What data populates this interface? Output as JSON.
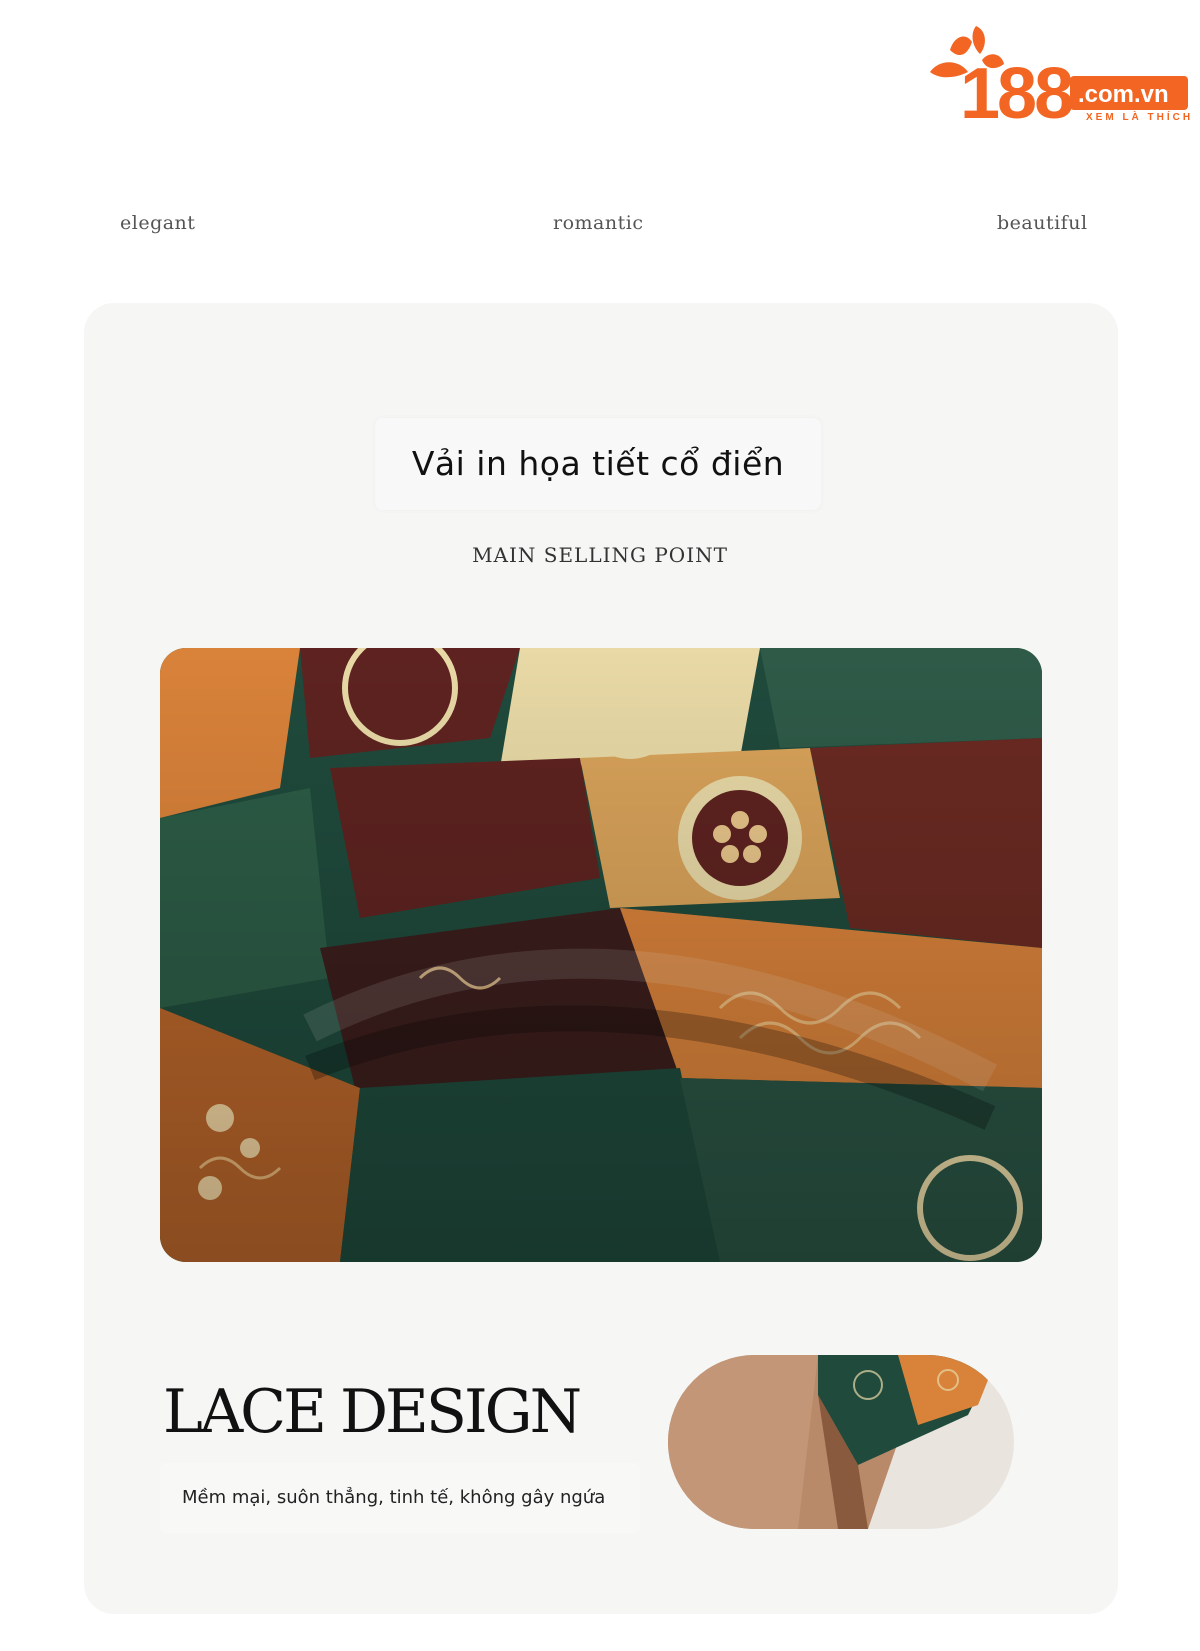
{
  "logo": {
    "number": "188",
    "domain": ".com.vn",
    "slogan": "XEM LÀ THÍCH",
    "brand_color": "#f26522"
  },
  "tags": [
    "elegant",
    "romantic",
    "beautiful"
  ],
  "section": {
    "title": "Vải in họa tiết cổ điển",
    "subtitle": "MAIN SELLING POINT"
  },
  "lace": {
    "title": "LACE DESIGN",
    "description": "Mềm mại, suôn thẳng, tinh tế, không gây ngứa"
  },
  "colors": {
    "card_background": "#f6f6f5",
    "fabric_green": "#1f4a3c",
    "fabric_orange": "#d9823a",
    "fabric_maroon": "#5e2320",
    "fabric_cream": "#e8d9a6",
    "lace_tan": "#b98a6a"
  }
}
